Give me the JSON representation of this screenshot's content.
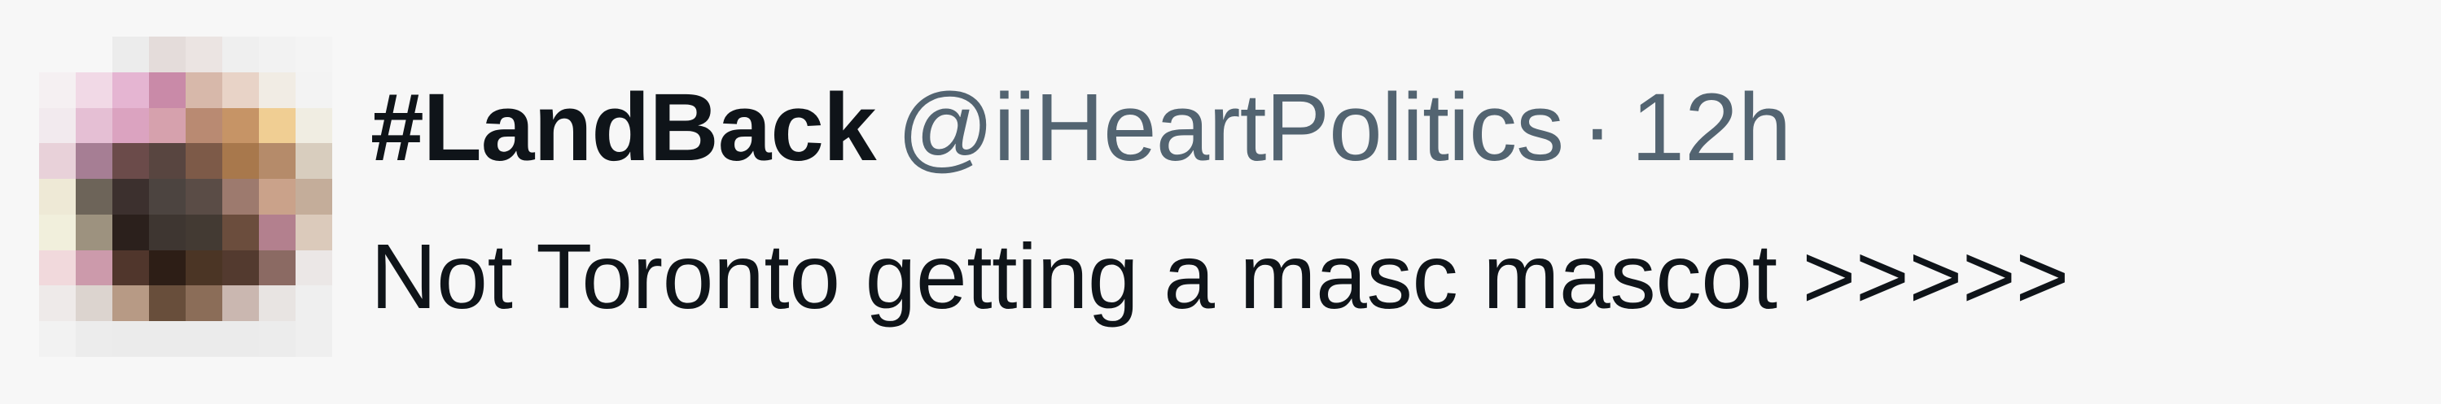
{
  "tweet": {
    "display_name": "#LandBack",
    "handle": "@iiHeartPolitics",
    "separator": "·",
    "timestamp": "12h",
    "text": "Not Toronto getting a masc mascot >>>>>"
  },
  "avatar": {
    "icon": "pixelated-avatar-image",
    "pixels": [
      "#f7f7f7",
      "#f7f7f7",
      "#ececec",
      "#e4dcda",
      "#ebe4e2",
      "#efefef",
      "#f2f2f2",
      "#f4f4f4",
      "#f5f0f2",
      "#f1d9e6",
      "#e5b5d2",
      "#c98aa8",
      "#d7b8aa",
      "#e8d3c7",
      "#f1ece4",
      "#f3f3f3",
      "#f2eaee",
      "#e5bfd4",
      "#dba3c0",
      "#d6a1ad",
      "#b98a72",
      "#c69466",
      "#f0ce93",
      "#f0ede2",
      "#e8d1d9",
      "#a67e94",
      "#6b4b4a",
      "#584540",
      "#7d5a48",
      "#a8784c",
      "#b58b6a",
      "#d8cdbe",
      "#eee9d6",
      "#6d6459",
      "#3c302e",
      "#4c4440",
      "#5a4c46",
      "#9d7a6e",
      "#caa28a",
      "#c4ad9a",
      "#f1efdc",
      "#9d927f",
      "#2b201c",
      "#3e3631",
      "#433a33",
      "#6b4d3d",
      "#b3808e",
      "#dbcabb",
      "#f1d9dc",
      "#cc9aab",
      "#50362c",
      "#2d1e16",
      "#4b3525",
      "#533a2f",
      "#8b6a63",
      "#ebe7e6",
      "#eeeae9",
      "#dcd4cf",
      "#b79a85",
      "#684e3b",
      "#8b6d58",
      "#cab7b0",
      "#e8e4e2",
      "#efefef",
      "#f2f2f2",
      "#ececec",
      "#ebebeb",
      "#ebebeb",
      "#ebebeb",
      "#ebebeb",
      "#ececec",
      "#efefef"
    ]
  }
}
